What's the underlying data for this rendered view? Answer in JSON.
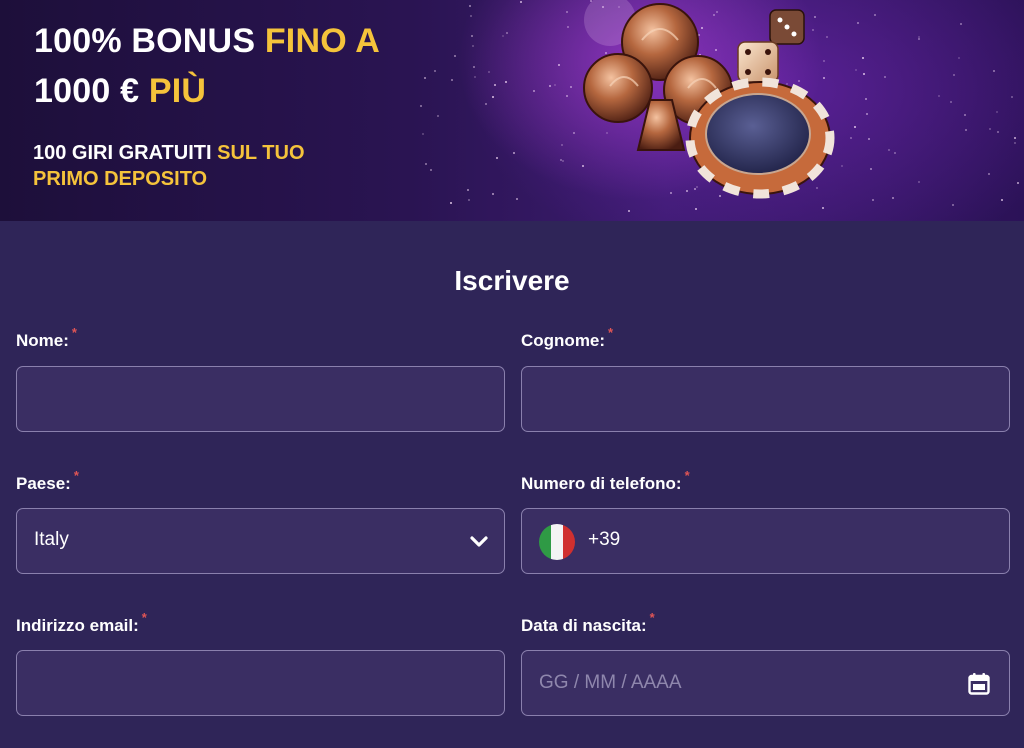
{
  "banner": {
    "headline_line1_white": "100% BONUS ",
    "headline_line1_gold": "FINO A",
    "headline_line2_white": "1000 € ",
    "headline_line2_gold": "PIÙ",
    "sub_line1_white": "100 GIRI GRATUITI ",
    "sub_line1_gold": "SUL TUO",
    "sub_line2_gold": "PRIMO DEPOSITO",
    "artwork_icons": [
      "club-ornament-icon",
      "dice-icon",
      "casino-chip-icon"
    ]
  },
  "form": {
    "title": "Iscrivere",
    "required_mark": "*",
    "fields": {
      "first_name": {
        "label": "Nome:",
        "value": "",
        "placeholder": ""
      },
      "last_name": {
        "label": "Cognome:",
        "value": "",
        "placeholder": ""
      },
      "country": {
        "label": "Paese:",
        "value": "Italy"
      },
      "phone": {
        "label": "Numero di telefono:",
        "prefix": "+39",
        "flag": "italy-flag-icon"
      },
      "email": {
        "label": "Indirizzo email:",
        "value": "",
        "placeholder": ""
      },
      "birth_date": {
        "label": "Data di nascita:",
        "value": "",
        "placeholder": "GG / MM / AAAA",
        "icon": "calendar-icon"
      }
    }
  },
  "colors": {
    "accent_gold": "#f5c33b",
    "form_background": "#2f2558",
    "field_background": "#3a2e63",
    "field_border": "#8a80ad",
    "required_mark": "#e05555",
    "flag_green": "#2f9a45",
    "flag_white": "#f4f4f4",
    "flag_red": "#d0302f"
  }
}
